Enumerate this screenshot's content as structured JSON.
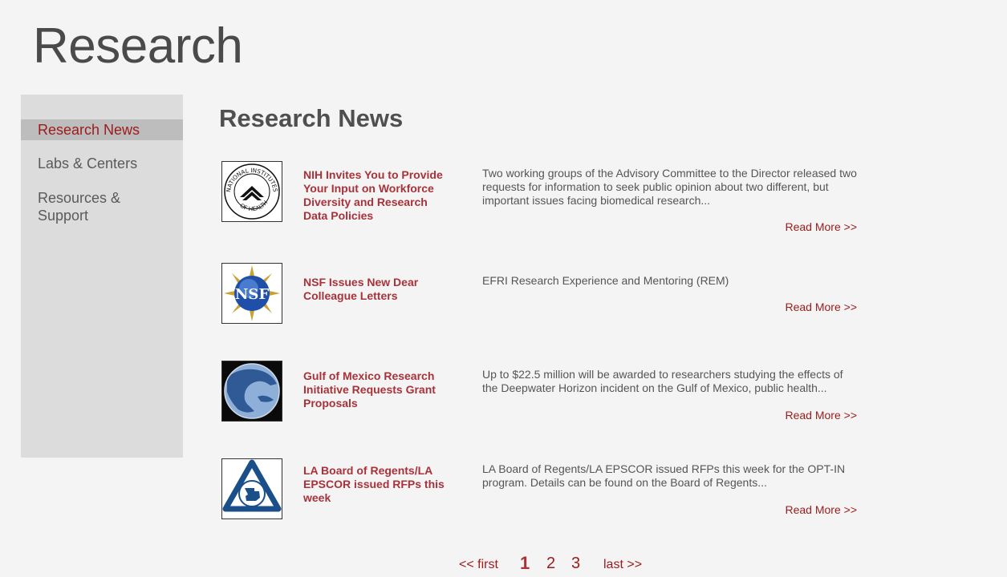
{
  "page": {
    "title": "Research"
  },
  "sidebar": {
    "items": [
      {
        "label": "Research News",
        "active": true
      },
      {
        "label": "Labs & Centers",
        "active": false
      },
      {
        "label": "Resources & Support",
        "active": false
      }
    ]
  },
  "main": {
    "section_title": "Research News",
    "news": [
      {
        "icon": "nih-seal-icon",
        "headline": "NIH Invites You to Provide Your Input on Workforce Diversity and Research Data Policies",
        "summary": "Two working groups of the Advisory Committee to the Director released two requests for information to seek public opinion about two different, but important issues facing biomedical research...",
        "read_more": "Read More >>",
        "logo_text": [
          "NATIONAL INSTITUTES",
          "OF HEALTH"
        ]
      },
      {
        "icon": "nsf-logo-icon",
        "headline": "NSF Issues New Dear Colleague Letters",
        "summary": "EFRI Research Experience and Mentoring (REM)",
        "read_more": "Read More >>",
        "logo_text": [
          "NSF"
        ]
      },
      {
        "icon": "gulf-map-icon",
        "headline": "Gulf of Mexico Research Initiative Requests Grant Proposals",
        "summary": "Up to $22.5 million will be awarded to researchers studying the effects of the Deepwater Horizon incident on the Gulf of Mexico, public health...",
        "read_more": "Read More >>"
      },
      {
        "icon": "louisiana-regents-logo-icon",
        "headline": "LA Board of Regents/LA EPSCOR issued RFPs this week",
        "summary": "LA Board of Regents/LA EPSCOR issued RFPs this week for the OPT-IN program. Details can be found on the Board of Regents...",
        "read_more": "Read More >>"
      }
    ]
  },
  "pager": {
    "first": "<< first",
    "pages": [
      "1",
      "2",
      "3"
    ],
    "current": "1",
    "last": "last >>"
  },
  "colors": {
    "accent": "#9b1b1b",
    "headline": "#a8323a",
    "sidebar_bg": "#dcdcdc",
    "sidebar_active_bg": "#bdbdbd",
    "page_bg": "#f4f4f4"
  }
}
